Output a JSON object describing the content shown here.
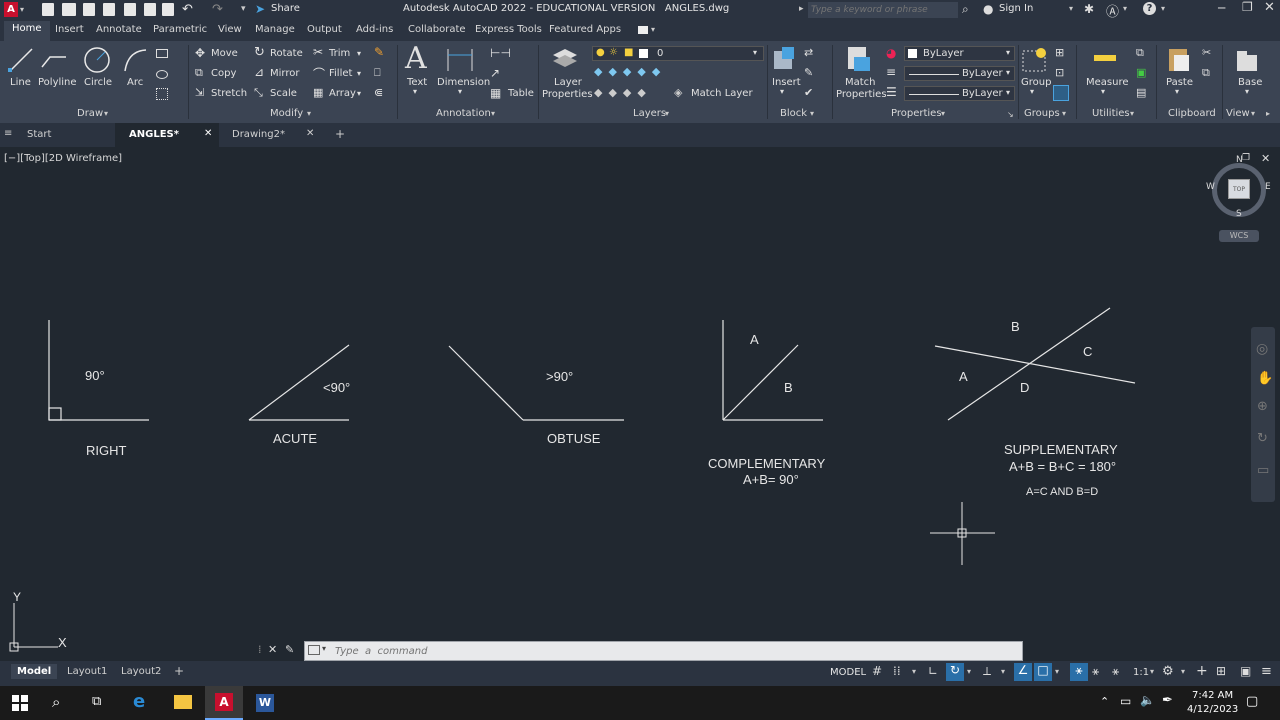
{
  "titlebar": {
    "app_title": "Autodesk AutoCAD 2022 - EDUCATIONAL VERSION   ANGLES.dwg",
    "share": "Share",
    "search_placeholder": "Type a keyword or phrase",
    "sign_in": "Sign In"
  },
  "ribbon_tabs": [
    "Home",
    "Insert",
    "Annotate",
    "Parametric",
    "View",
    "Manage",
    "Output",
    "Add-ins",
    "Collaborate",
    "Express Tools",
    "Featured Apps"
  ],
  "ribbon": {
    "draw": {
      "line": "Line",
      "polyline": "Polyline",
      "circle": "Circle",
      "arc": "Arc",
      "panel": "Draw"
    },
    "modify": {
      "move": "Move",
      "rotate": "Rotate",
      "trim": "Trim",
      "copy": "Copy",
      "mirror": "Mirror",
      "fillet": "Fillet",
      "stretch": "Stretch",
      "scale": "Scale",
      "array": "Array",
      "panel": "Modify"
    },
    "annotation": {
      "text": "Text",
      "dimension": "Dimension",
      "table": "Table",
      "panel": "Annotation"
    },
    "layers": {
      "layer_properties_1": "Layer",
      "layer_properties_2": "Properties",
      "layer_value": "0",
      "match_layer": "Match Layer",
      "panel": "Layers"
    },
    "block": {
      "insert": "Insert",
      "panel": "Block"
    },
    "properties": {
      "match_1": "Match",
      "match_2": "Properties",
      "bylayer1": "ByLayer",
      "bylayer2": "ByLayer",
      "bylayer3": "ByLayer",
      "panel": "Properties"
    },
    "groups": {
      "group": "Group",
      "panel": "Groups"
    },
    "utilities": {
      "measure": "Measure",
      "panel": "Utilities"
    },
    "clipboard": {
      "paste": "Paste",
      "panel": "Clipboard"
    },
    "view": {
      "base": "Base",
      "panel": "View"
    }
  },
  "doc_tabs": {
    "start": "Start",
    "angles": "ANGLES*",
    "drawing2": "Drawing2*"
  },
  "viewport": {
    "label": "[−][Top][2D Wireframe]",
    "viewcube": {
      "n": "N",
      "s": "S",
      "e": "E",
      "w": "W",
      "top": "TOP",
      "wcs": "WCS"
    },
    "ucs": {
      "x": "X",
      "y": "Y"
    }
  },
  "drawing": {
    "right_angle": "90°",
    "right_label": "RIGHT",
    "acute_angle": "<90°",
    "acute_label": "ACUTE",
    "obtuse_angle": ">90°",
    "obtuse_label": "OBTUSE",
    "comp_a": "A",
    "comp_b": "B",
    "comp_label": "COMPLEMENTARY",
    "comp_formula": "A+B= 90°",
    "supp_a": "A",
    "supp_b": "B",
    "supp_c": "C",
    "supp_d": "D",
    "supp_label": "SUPPLEMENTARY",
    "supp_formula": "A+B = B+C = 180°",
    "supp_note": "A=C AND B=D"
  },
  "command": {
    "placeholder": "Type  a  command"
  },
  "layout_tabs": [
    "Model",
    "Layout1",
    "Layout2"
  ],
  "status": {
    "model": "MODEL",
    "scale": "1:1"
  },
  "taskbar": {
    "time": "7:42 AM",
    "date": "4/12/2023"
  },
  "colors": {
    "accent": "#2a8ad4",
    "canvas": "#212830",
    "ribbon": "#3b4453"
  }
}
